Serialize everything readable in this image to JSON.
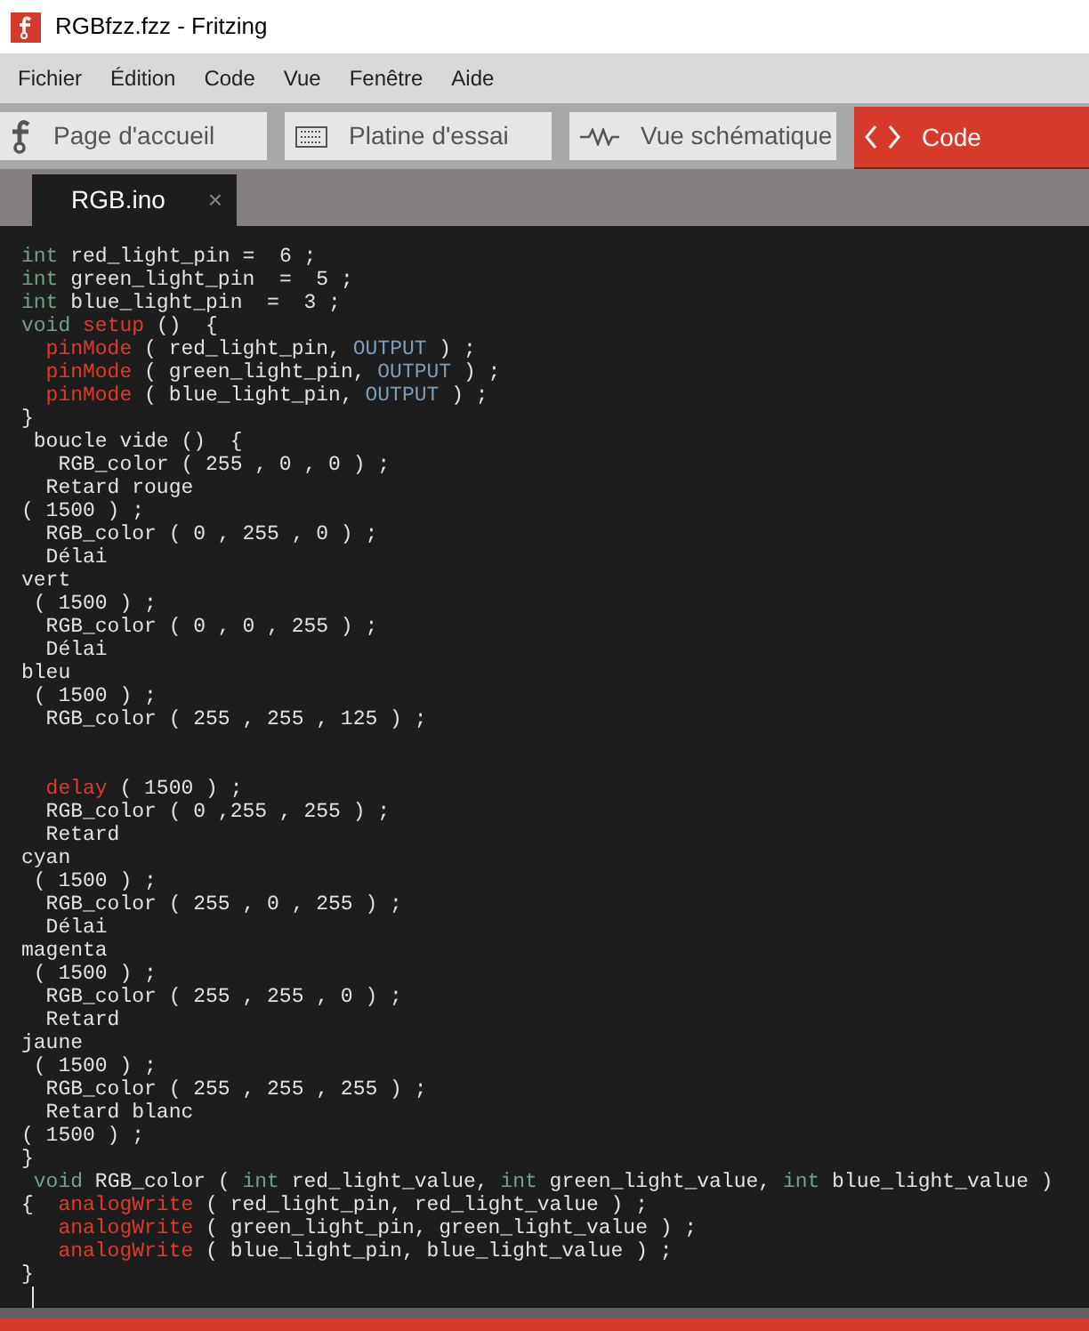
{
  "window": {
    "title": "RGBfzz.fzz - Fritzing"
  },
  "menu": [
    "Fichier",
    "Édition",
    "Code",
    "Vue",
    "Fenêtre",
    "Aide"
  ],
  "view_tabs": [
    {
      "label": "Page d'accueil",
      "kind": "welcome",
      "selected": false
    },
    {
      "label": "Platine d'essai",
      "kind": "breadboard",
      "selected": false
    },
    {
      "label": "Vue schématique",
      "kind": "schematic",
      "selected": false
    },
    {
      "label": "Code",
      "kind": "code",
      "selected": true
    }
  ],
  "file_tabs": [
    {
      "label": "RGB.ino",
      "close": "×",
      "selected": true
    }
  ],
  "code_lines": [
    {
      "kind": "code",
      "tokens": [
        {
          "kind": "type",
          "text": "int"
        },
        {
          "kind": "plain",
          "text": " red_light_pin =  6 ;"
        }
      ]
    },
    {
      "kind": "code",
      "tokens": [
        {
          "kind": "type",
          "text": "int"
        },
        {
          "kind": "plain",
          "text": " green_light_pin  =  5 ;"
        }
      ]
    },
    {
      "kind": "code",
      "tokens": [
        {
          "kind": "type",
          "text": "int"
        },
        {
          "kind": "plain",
          "text": " blue_light_pin  =  3 ;"
        }
      ]
    },
    {
      "kind": "code",
      "tokens": [
        {
          "kind": "type",
          "text": "void"
        },
        {
          "kind": "func",
          "text": " setup"
        },
        {
          "kind": "plain",
          "text": " ()  {"
        }
      ]
    },
    {
      "kind": "code",
      "tokens": [
        {
          "kind": "func",
          "text": "  pinMode"
        },
        {
          "kind": "plain",
          "text": " ( red_light_pin, "
        },
        {
          "kind": "const",
          "text": "OUTPUT"
        },
        {
          "kind": "plain",
          "text": " ) ;"
        }
      ]
    },
    {
      "kind": "code",
      "tokens": [
        {
          "kind": "func",
          "text": "  pinMode"
        },
        {
          "kind": "plain",
          "text": " ( green_light_pin, "
        },
        {
          "kind": "const",
          "text": "OUTPUT"
        },
        {
          "kind": "plain",
          "text": " ) ;"
        }
      ]
    },
    {
      "kind": "code",
      "tokens": [
        {
          "kind": "func",
          "text": "  pinMode"
        },
        {
          "kind": "plain",
          "text": " ( blue_light_pin, "
        },
        {
          "kind": "const",
          "text": "OUTPUT"
        },
        {
          "kind": "plain",
          "text": " ) ;"
        }
      ]
    },
    {
      "kind": "code",
      "tokens": [
        {
          "kind": "plain",
          "text": "}"
        }
      ]
    },
    {
      "kind": "code",
      "tokens": [
        {
          "kind": "plain",
          "text": " boucle vide ()  {"
        }
      ]
    },
    {
      "kind": "code",
      "tokens": [
        {
          "kind": "plain",
          "text": "   RGB_color ( 255 , 0 , 0 ) ;"
        }
      ]
    },
    {
      "kind": "code",
      "tokens": [
        {
          "kind": "plain",
          "text": "  Retard rouge"
        }
      ]
    },
    {
      "kind": "code",
      "tokens": [
        {
          "kind": "plain",
          "text": "( 1500 ) ;"
        }
      ]
    },
    {
      "kind": "code",
      "tokens": [
        {
          "kind": "plain",
          "text": "  RGB_color ( 0 , 255 , 0 ) ;"
        }
      ]
    },
    {
      "kind": "code",
      "tokens": [
        {
          "kind": "plain",
          "text": "  Délai"
        }
      ]
    },
    {
      "kind": "code",
      "tokens": [
        {
          "kind": "plain",
          "text": "vert"
        }
      ]
    },
    {
      "kind": "code",
      "tokens": [
        {
          "kind": "plain",
          "text": " ( 1500 ) ;"
        }
      ]
    },
    {
      "kind": "code",
      "tokens": [
        {
          "kind": "plain",
          "text": "  RGB_color ( 0 , 0 , 255 ) ;"
        }
      ]
    },
    {
      "kind": "code",
      "tokens": [
        {
          "kind": "plain",
          "text": "  Délai"
        }
      ]
    },
    {
      "kind": "code",
      "tokens": [
        {
          "kind": "plain",
          "text": "bleu"
        }
      ]
    },
    {
      "kind": "code",
      "tokens": [
        {
          "kind": "plain",
          "text": " ( 1500 ) ;"
        }
      ]
    },
    {
      "kind": "code",
      "tokens": [
        {
          "kind": "plain",
          "text": "  RGB_color ( 255 , 255 , 125 ) ;"
        }
      ]
    },
    {
      "kind": "blank"
    },
    {
      "kind": "blank"
    },
    {
      "kind": "code",
      "tokens": [
        {
          "kind": "func",
          "text": "  delay"
        },
        {
          "kind": "plain",
          "text": " ( 1500 ) ;"
        }
      ]
    },
    {
      "kind": "code",
      "tokens": [
        {
          "kind": "plain",
          "text": "  RGB_color ( 0 ,255 , 255 ) ;"
        }
      ]
    },
    {
      "kind": "code",
      "tokens": [
        {
          "kind": "plain",
          "text": "  Retard"
        }
      ]
    },
    {
      "kind": "code",
      "tokens": [
        {
          "kind": "plain",
          "text": "cyan"
        }
      ]
    },
    {
      "kind": "code",
      "tokens": [
        {
          "kind": "plain",
          "text": " ( 1500 ) ;"
        }
      ]
    },
    {
      "kind": "code",
      "tokens": [
        {
          "kind": "plain",
          "text": "  RGB_color ( 255 , 0 , 255 ) ;"
        }
      ]
    },
    {
      "kind": "code",
      "tokens": [
        {
          "kind": "plain",
          "text": "  Délai"
        }
      ]
    },
    {
      "kind": "code",
      "tokens": [
        {
          "kind": "plain",
          "text": "magenta"
        }
      ]
    },
    {
      "kind": "code",
      "tokens": [
        {
          "kind": "plain",
          "text": " ( 1500 ) ;"
        }
      ]
    },
    {
      "kind": "code",
      "tokens": [
        {
          "kind": "plain",
          "text": "  RGB_color ( 255 , 255 , 0 ) ;"
        }
      ]
    },
    {
      "kind": "code",
      "tokens": [
        {
          "kind": "plain",
          "text": "  Retard"
        }
      ]
    },
    {
      "kind": "code",
      "tokens": [
        {
          "kind": "plain",
          "text": "jaune"
        }
      ]
    },
    {
      "kind": "code",
      "tokens": [
        {
          "kind": "plain",
          "text": " ( 1500 ) ;"
        }
      ]
    },
    {
      "kind": "code",
      "tokens": [
        {
          "kind": "plain",
          "text": "  RGB_color ( 255 , 255 , 255 ) ;"
        }
      ]
    },
    {
      "kind": "code",
      "tokens": [
        {
          "kind": "plain",
          "text": "  Retard blanc"
        }
      ]
    },
    {
      "kind": "code",
      "tokens": [
        {
          "kind": "plain",
          "text": "( 1500 ) ;"
        }
      ]
    },
    {
      "kind": "code",
      "tokens": [
        {
          "kind": "plain",
          "text": "}"
        }
      ]
    },
    {
      "kind": "code",
      "tokens": [
        {
          "kind": "type",
          "text": " void"
        },
        {
          "kind": "plain",
          "text": " RGB_color ( "
        },
        {
          "kind": "type",
          "text": "int"
        },
        {
          "kind": "plain",
          "text": " red_light_value, "
        },
        {
          "kind": "type",
          "text": "int"
        },
        {
          "kind": "plain",
          "text": " green_light_value, "
        },
        {
          "kind": "type",
          "text": "int"
        },
        {
          "kind": "plain",
          "text": " blue_light_value )"
        }
      ]
    },
    {
      "kind": "code",
      "tokens": [
        {
          "kind": "plain",
          "text": "{  "
        },
        {
          "kind": "func",
          "text": "analogWrite"
        },
        {
          "kind": "plain",
          "text": " ( red_light_pin, red_light_value ) ;"
        }
      ]
    },
    {
      "kind": "code",
      "tokens": [
        {
          "kind": "func",
          "text": "   analogWrite"
        },
        {
          "kind": "plain",
          "text": " ( green_light_pin, green_light_value ) ;"
        }
      ]
    },
    {
      "kind": "code",
      "tokens": [
        {
          "kind": "func",
          "text": "   analogWrite"
        },
        {
          "kind": "plain",
          "text": " ( blue_light_pin, blue_light_value ) ;"
        }
      ]
    },
    {
      "kind": "code",
      "tokens": [
        {
          "kind": "plain",
          "text": "}"
        }
      ]
    },
    {
      "kind": "cursor"
    }
  ]
}
